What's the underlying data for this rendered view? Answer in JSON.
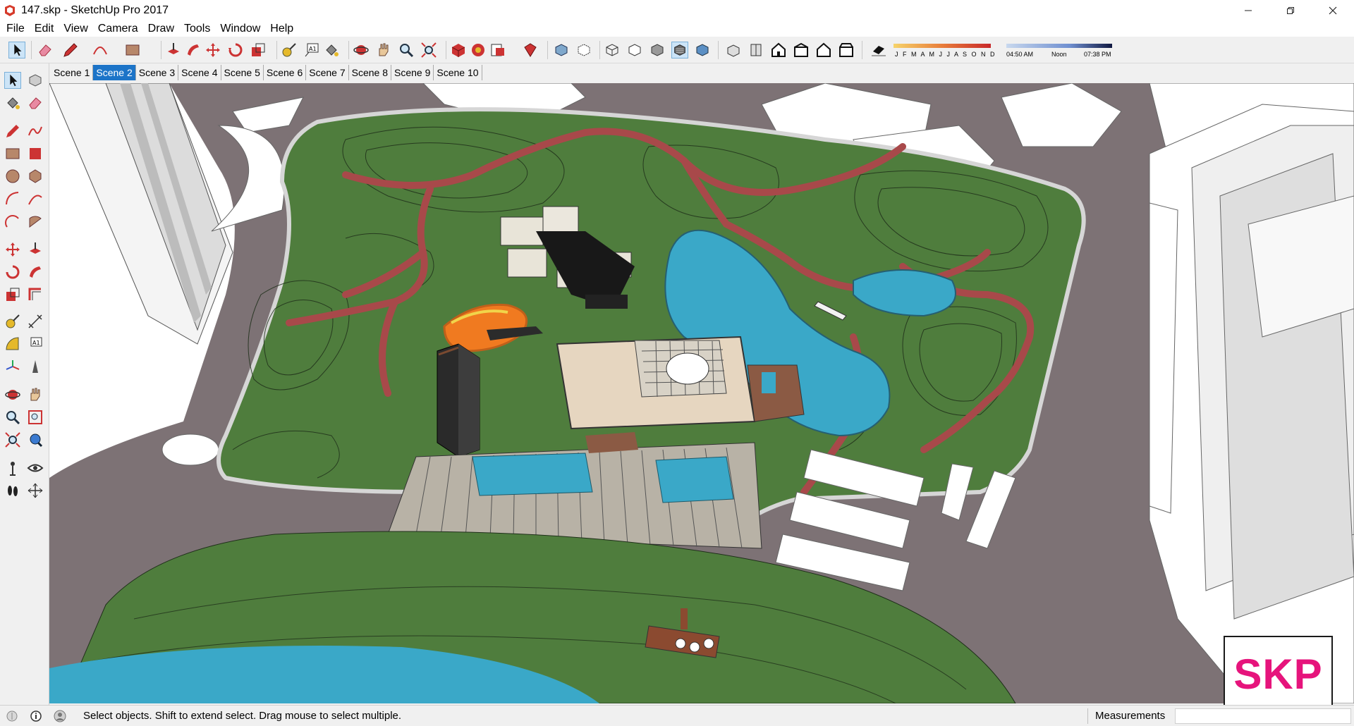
{
  "window": {
    "title": "147.skp - SketchUp Pro 2017",
    "controls": [
      "minimize",
      "maximize",
      "close"
    ]
  },
  "menu": [
    "File",
    "Edit",
    "View",
    "Camera",
    "Draw",
    "Tools",
    "Window",
    "Help"
  ],
  "toolbar": {
    "icons": [
      "select-icon",
      "eraser-icon",
      "pencil-icon",
      "arc-icon",
      "rectangle-icon",
      "push-pull-icon",
      "follow-me-icon",
      "move-icon",
      "rotate-icon",
      "scale-icon",
      "tape-measure-icon",
      "text-icon",
      "paint-bucket-icon",
      "orbit-icon",
      "pan-icon",
      "zoom-icon",
      "zoom-extents-icon",
      "warehouse-icon",
      "extension-warehouse-icon",
      "send-to-layout-icon",
      "extension-manager-icon",
      "xray-icon",
      "back-edges-icon",
      "wireframe-icon",
      "hidden-line-icon",
      "shaded-icon",
      "shaded-textures-icon",
      "monochrome-icon",
      "iso-view-icon",
      "top-view-icon",
      "front-view-icon",
      "right-view-icon",
      "back-view-icon",
      "left-view-icon",
      "shadows-toggle-icon"
    ],
    "active_icon": "shaded-textures-icon"
  },
  "shadows": {
    "months_label": "J F M A M J J A S O N D",
    "time_start": "04:50 AM",
    "time_mid": "Noon",
    "time_end": "07:38 PM"
  },
  "palette": {
    "icons": [
      "select-icon",
      "make-component-icon",
      "paint-bucket-icon",
      "eraser-icon",
      "line-icon",
      "freehand-icon",
      "rectangle-icon",
      "rotated-rectangle-icon",
      "circle-icon",
      "polygon-icon",
      "arc-icon",
      "two-point-arc-icon",
      "three-point-arc-icon",
      "pie-icon",
      "move-icon",
      "push-pull-icon",
      "rotate-icon",
      "follow-me-icon",
      "scale-icon",
      "offset-icon",
      "tape-measure-icon",
      "dimension-icon",
      "protractor-icon",
      "text-icon",
      "axes-icon",
      "3d-text-icon",
      "orbit-icon",
      "pan-icon",
      "zoom-icon",
      "zoom-window-icon",
      "zoom-extents-icon",
      "previous-view-icon",
      "position-camera-icon",
      "look-around-icon",
      "walk-icon",
      "section-plane-icon"
    ]
  },
  "scenes": {
    "tabs": [
      "Scene 1",
      "Scene 2",
      "Scene 3",
      "Scene 4",
      "Scene 5",
      "Scene 6",
      "Scene 7",
      "Scene 8",
      "Scene 9",
      "Scene 10"
    ],
    "active": "Scene 2"
  },
  "badge": {
    "text": "SKP",
    "color": "#e6147c"
  },
  "status": {
    "message": "Select objects. Shift to extend select. Drag mouse to select multiple.",
    "measurements_label": "Measurements",
    "measurements_value": ""
  },
  "colors": {
    "road": "#7d7275",
    "lawn": "#4f7d3d",
    "path": "#a8494a",
    "water": "#3aa8c8",
    "selection": "#1c74c8"
  }
}
